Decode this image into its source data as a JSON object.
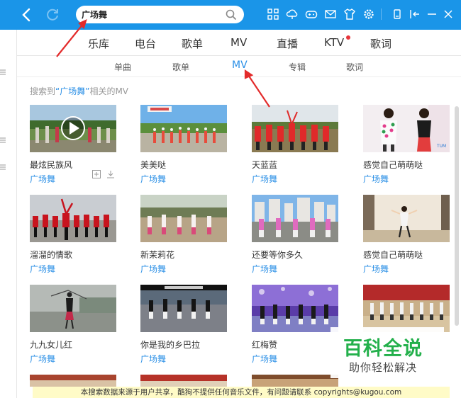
{
  "toolbar": {
    "back_icon": "back-arrow-icon",
    "refresh_icon": "refresh-icon",
    "search_value": "广场舞",
    "search_placeholder": "搜索",
    "icons": [
      "grid-icon",
      "cloud-icon",
      "gamepad-icon",
      "mail-icon",
      "shirt-icon",
      "gear-icon",
      "mini-player-icon",
      "collapse-icon",
      "minimize-icon",
      "close-icon"
    ]
  },
  "main_tabs": [
    "乐库",
    "电台",
    "歌单",
    "MV",
    "直播",
    "KTV",
    "歌词"
  ],
  "sub_tabs": [
    "单曲",
    "歌单",
    "MV",
    "专辑",
    "歌词"
  ],
  "active_sub_tab": "MV",
  "result_text": {
    "prefix": "搜索到",
    "keyword": "“广场舞”",
    "suffix": "相关的MV"
  },
  "mv_items": [
    {
      "title": "最炫民族风",
      "artist": "广场舞"
    },
    {
      "title": "美美哒",
      "artist": "广场舞"
    },
    {
      "title": "天蓝蓝",
      "artist": "广场舞"
    },
    {
      "title": "感觉自己萌萌哒",
      "artist": "广场舞"
    },
    {
      "title": "溜溜的情歌",
      "artist": "广场舞"
    },
    {
      "title": "新茉莉花",
      "artist": "广场舞"
    },
    {
      "title": "还要等你多久",
      "artist": "广场舞"
    },
    {
      "title": "感觉自己萌萌哒",
      "artist": "广场舞"
    },
    {
      "title": "九九女儿红",
      "artist": "广场舞"
    },
    {
      "title": "你是我的乡巴拉",
      "artist": "广场舞"
    },
    {
      "title": "红梅赞",
      "artist": "广场舞"
    },
    {
      "title": "",
      "artist": ""
    }
  ],
  "watermark": {
    "title": "百科全说",
    "subtitle": "助你轻松解决"
  },
  "notice": "本搜索数据来源于用户共享，酷狗不提供任何音乐文件，有问题请联系 copyrights@kugou.com",
  "colors": {
    "topbar": "#1a95e8",
    "accent": "#2a8fe6",
    "annotation_arrow": "#e32b2b",
    "watermark_green": "#23b04b",
    "notice_bg": "#fffbc7"
  }
}
